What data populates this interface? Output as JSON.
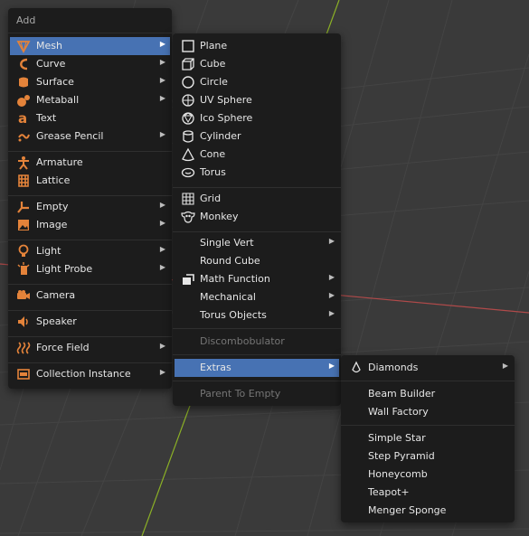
{
  "add_menu": {
    "title": "Add",
    "items": [
      {
        "label": "Mesh",
        "icon": "mesh-cone-icon"
      },
      {
        "label": "Curve",
        "icon": "curve-icon"
      },
      {
        "label": "Surface",
        "icon": "surface-icon"
      },
      {
        "label": "Metaball",
        "icon": "metaball-icon"
      },
      {
        "label": "Text",
        "icon": "text-icon"
      },
      {
        "label": "Grease Pencil",
        "icon": "grease-pencil-icon"
      },
      {
        "label": "Armature",
        "icon": "armature-icon"
      },
      {
        "label": "Lattice",
        "icon": "lattice-icon"
      },
      {
        "label": "Empty",
        "icon": "empty-icon"
      },
      {
        "label": "Image",
        "icon": "image-icon"
      },
      {
        "label": "Light",
        "icon": "light-icon"
      },
      {
        "label": "Light Probe",
        "icon": "light-probe-icon"
      },
      {
        "label": "Camera",
        "icon": "camera-icon"
      },
      {
        "label": "Speaker",
        "icon": "speaker-icon"
      },
      {
        "label": "Force Field",
        "icon": "force-field-icon"
      },
      {
        "label": "Collection Instance",
        "icon": "collection-icon"
      }
    ]
  },
  "mesh_menu": {
    "items": [
      {
        "label": "Plane",
        "icon": "plane-icon"
      },
      {
        "label": "Cube",
        "icon": "cube-icon"
      },
      {
        "label": "Circle",
        "icon": "circle-icon"
      },
      {
        "label": "UV Sphere",
        "icon": "uv-sphere-icon"
      },
      {
        "label": "Ico Sphere",
        "icon": "ico-sphere-icon"
      },
      {
        "label": "Cylinder",
        "icon": "cylinder-icon"
      },
      {
        "label": "Cone",
        "icon": "cone-icon"
      },
      {
        "label": "Torus",
        "icon": "torus-icon"
      },
      {
        "label": "Grid",
        "icon": "grid-icon"
      },
      {
        "label": "Monkey",
        "icon": "monkey-icon"
      },
      {
        "label": "Single Vert"
      },
      {
        "label": "Round Cube"
      },
      {
        "label": "Math Function",
        "icon": "math-function-icon"
      },
      {
        "label": "Mechanical"
      },
      {
        "label": "Torus Objects"
      },
      {
        "label": "Discombobulator"
      },
      {
        "label": "Extras"
      },
      {
        "label": "Parent To Empty"
      }
    ]
  },
  "extras_menu": {
    "items": [
      {
        "label": "Diamonds",
        "icon": "diamond-icon"
      },
      {
        "label": "Beam Builder"
      },
      {
        "label": "Wall Factory"
      },
      {
        "label": "Simple Star"
      },
      {
        "label": "Step Pyramid"
      },
      {
        "label": "Honeycomb"
      },
      {
        "label": "Teapot+"
      },
      {
        "label": "Menger Sponge"
      }
    ]
  },
  "colors": {
    "highlight": "#4772b3",
    "menu_bg": "#1c1c1c",
    "viewport_bg": "#3a3a3a",
    "icon_orange": "#e4833a",
    "axis_green": "#8bb026",
    "axis_red": "#b04a4a"
  }
}
